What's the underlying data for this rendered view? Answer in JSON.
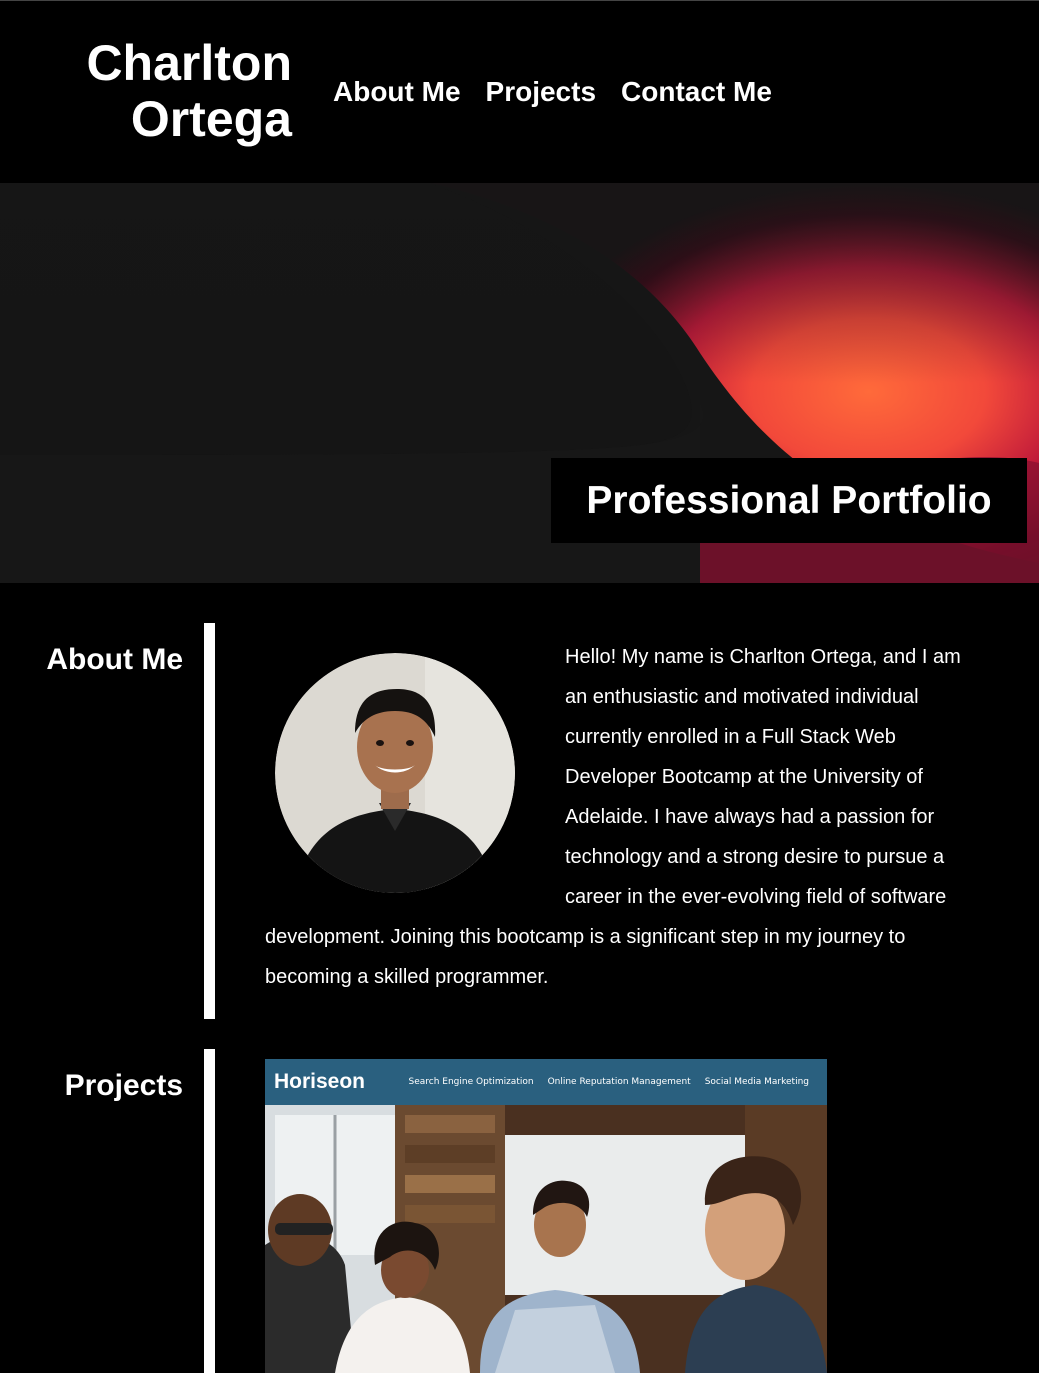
{
  "header": {
    "name_line1": "Charlton",
    "name_line2": "Ortega",
    "nav": {
      "about": "About Me",
      "projects": "Projects",
      "contact": "Contact Me"
    }
  },
  "hero": {
    "title": "Professional Portfolio"
  },
  "about": {
    "heading": "About Me",
    "avatar_alt": "profile photo",
    "text": "Hello! My name is Charlton Ortega, and I am an enthusiastic and motivated individual currently enrolled in a Full Stack Web Developer Bootcamp at the University of Adelaide. I have always had a passion for technology and a strong desire to pursue a career in the ever-evolving field of software development. Joining this bootcamp is a significant step in my journey to becoming a skilled programmer."
  },
  "projects": {
    "heading": "Projects",
    "items": [
      {
        "brand": "Horiseon",
        "nav": [
          "Search Engine Optimization",
          "Online Reputation Management",
          "Social Media Marketing"
        ]
      }
    ]
  },
  "colors": {
    "background": "#000000",
    "text": "#ffffff",
    "hero_accent_red": "#e2323c",
    "hero_accent_orange": "#ff5a3a",
    "project_bar": "#2a607f"
  }
}
